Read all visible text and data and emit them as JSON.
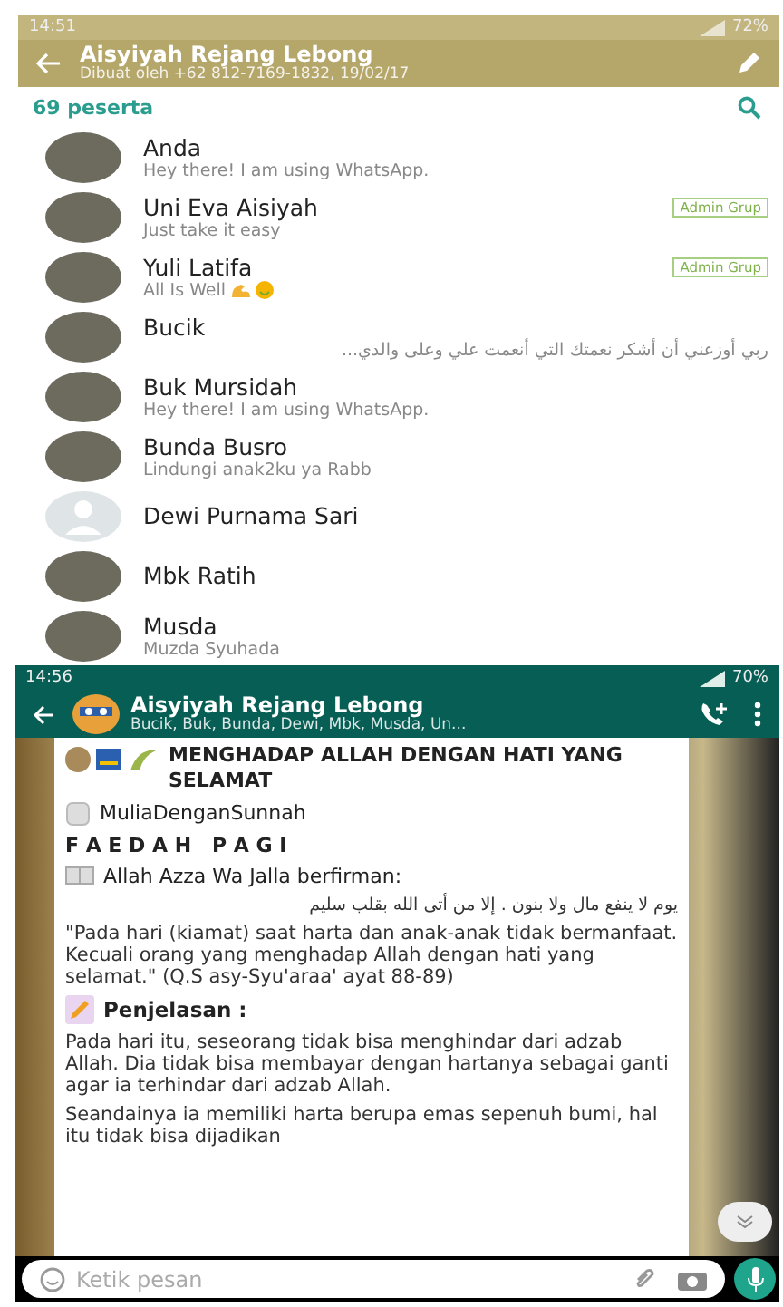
{
  "group_info": {
    "status_bar": {
      "time": "14:51",
      "battery": "72%"
    },
    "header": {
      "title": "Aisyiyah Rejang Lebong",
      "subtitle": "Dibuat oleh +62 812-7169-1832, 19/02/17"
    },
    "participants_count": "69 peserta",
    "members": [
      {
        "name": "Anda",
        "status": "Hey there! I am using WhatsApp.",
        "has_photo": true
      },
      {
        "name": "Uni Eva Aisiyah",
        "status": "Just take it easy",
        "badge": "Admin Grup",
        "has_photo": true
      },
      {
        "name": "Yuli Latifa",
        "status": "All Is Well",
        "badge": "Admin Grup",
        "has_photo": true,
        "emoji": true
      },
      {
        "name": "Bucik",
        "status": "ربي أوزعني أن أشكر نعمتك التي أنعمت علي وعلى والدي...",
        "has_photo": true,
        "rtl": true
      },
      {
        "name": "Buk Mursidah",
        "status": "Hey there! I am using WhatsApp.",
        "has_photo": true
      },
      {
        "name": "Bunda Busro",
        "status": "Lindungi anak2ku ya Rabb",
        "has_photo": true
      },
      {
        "name": "Dewi Purnama Sari",
        "has_photo": false
      },
      {
        "name": "Mbk Ratih",
        "has_photo": true
      },
      {
        "name": "Musda",
        "status": "Muzda Syuhada",
        "has_photo": true
      }
    ]
  },
  "chat": {
    "status_bar": {
      "time": "14:56",
      "battery": "70%"
    },
    "header": {
      "title": "Aisyiyah Rejang Lebong",
      "subtitle": "Bucik, Buk, Bunda, Dewi, Mbk, Musda, Un..."
    },
    "message": [
      {
        "kind": "heading",
        "text": "MENGHADAP ALLAH DENGAN HATI YANG SELAMAT"
      },
      {
        "kind": "tag",
        "text": "MuliaDenganSunnah"
      },
      {
        "kind": "spaced",
        "text": "F A E D A H   P A G I"
      },
      {
        "kind": "book",
        "text": "Allah Azza Wa Jalla berfirman:"
      },
      {
        "kind": "arabic",
        "text": "يوم لا ينفع مال ولا بنون . إلا من أتى الله بقلب سليم"
      },
      {
        "kind": "paragraph",
        "text": "\"Pada hari (kiamat) saat harta dan anak-anak tidak bermanfaat. Kecuali orang yang menghadap Allah dengan hati yang selamat.\" (Q.S asy-Syu'araa' ayat 88-89)"
      },
      {
        "kind": "subheading",
        "text": "Penjelasan :"
      },
      {
        "kind": "paragraph",
        "text": "Pada hari itu, seseorang tidak bisa menghindar dari adzab Allah. Dia tidak bisa membayar dengan hartanya sebagai ganti agar ia terhindar dari adzab Allah."
      },
      {
        "kind": "paragraph",
        "text": "Seandainya ia memiliki harta berupa emas sepenuh bumi, hal itu tidak bisa dijadikan"
      }
    ],
    "input": {
      "placeholder": "Ketik pesan"
    }
  }
}
